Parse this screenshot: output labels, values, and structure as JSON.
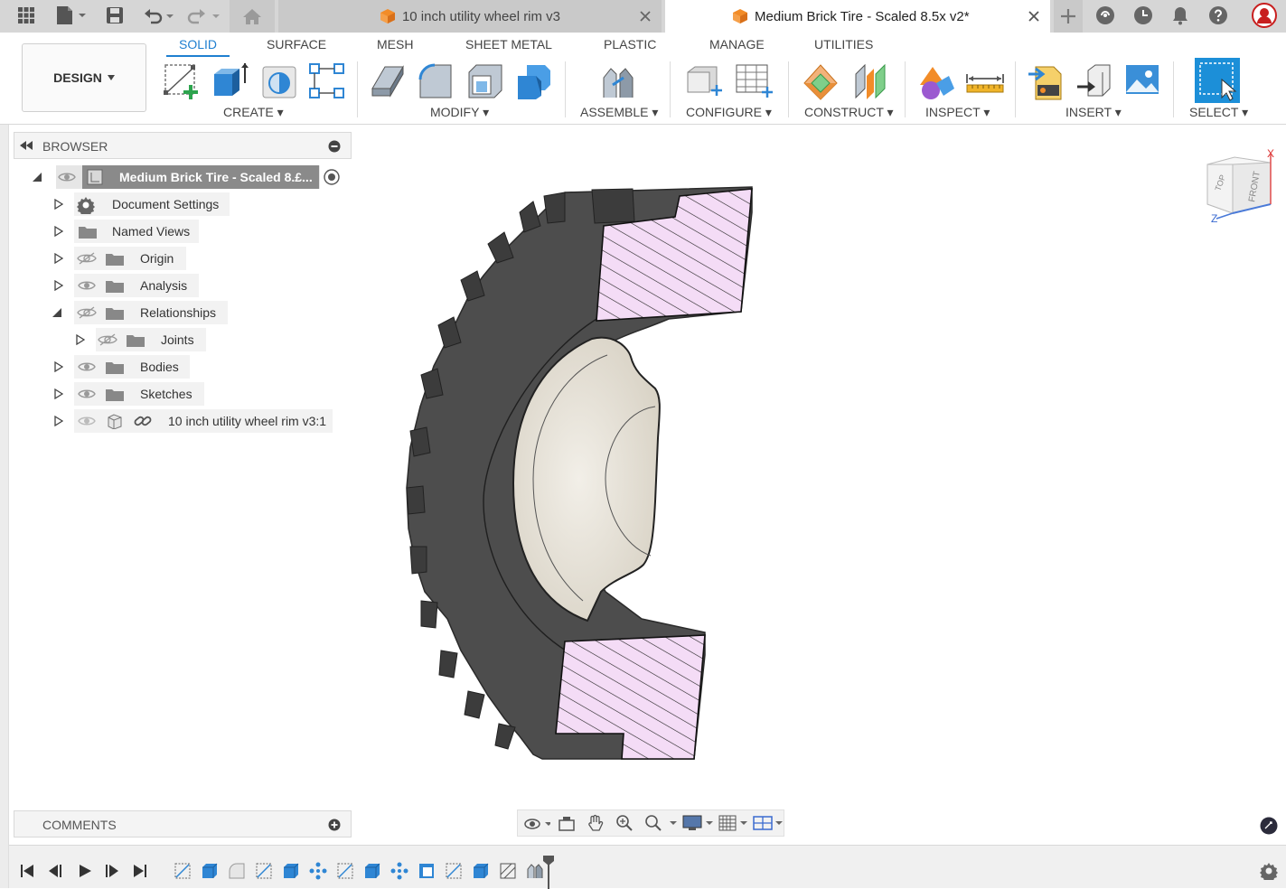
{
  "tabs": [
    {
      "label": "10 inch utility wheel rim v3",
      "active": false
    },
    {
      "label": "Medium Brick Tire - Scaled 8.5x v2*",
      "active": true
    }
  ],
  "workspace": {
    "label": "DESIGN"
  },
  "ribbon_tabs": [
    "SOLID",
    "SURFACE",
    "MESH",
    "SHEET METAL",
    "PLASTIC",
    "MANAGE",
    "UTILITIES"
  ],
  "ribbon_groups": {
    "create": "CREATE",
    "modify": "MODIFY",
    "assemble": "ASSEMBLE",
    "configure": "CONFIGURE",
    "construct": "CONSTRUCT",
    "inspect": "INSPECT",
    "insert": "INSERT",
    "select": "SELECT"
  },
  "browser": {
    "title": "BROWSER",
    "root": "Medium Brick Tire - Scaled 8.£...",
    "items": [
      {
        "label": "Document Settings"
      },
      {
        "label": "Named Views"
      },
      {
        "label": "Origin"
      },
      {
        "label": "Analysis"
      },
      {
        "label": "Relationships"
      },
      {
        "label": "Joints"
      },
      {
        "label": "Bodies"
      },
      {
        "label": "Sketches"
      },
      {
        "label": "10 inch utility wheel rim v3:1"
      }
    ]
  },
  "comments": {
    "title": "COMMENTS"
  },
  "viewcube": {
    "top": "TOP",
    "front": "FRONT",
    "x": "X",
    "z": "Z"
  },
  "colors": {
    "accent": "#1f7fd0",
    "tab_bg": "#d6d6d6",
    "tire": "#4a4a4a",
    "hatch_fill": "#f2d6f5",
    "rim": "#e6e1d6"
  }
}
